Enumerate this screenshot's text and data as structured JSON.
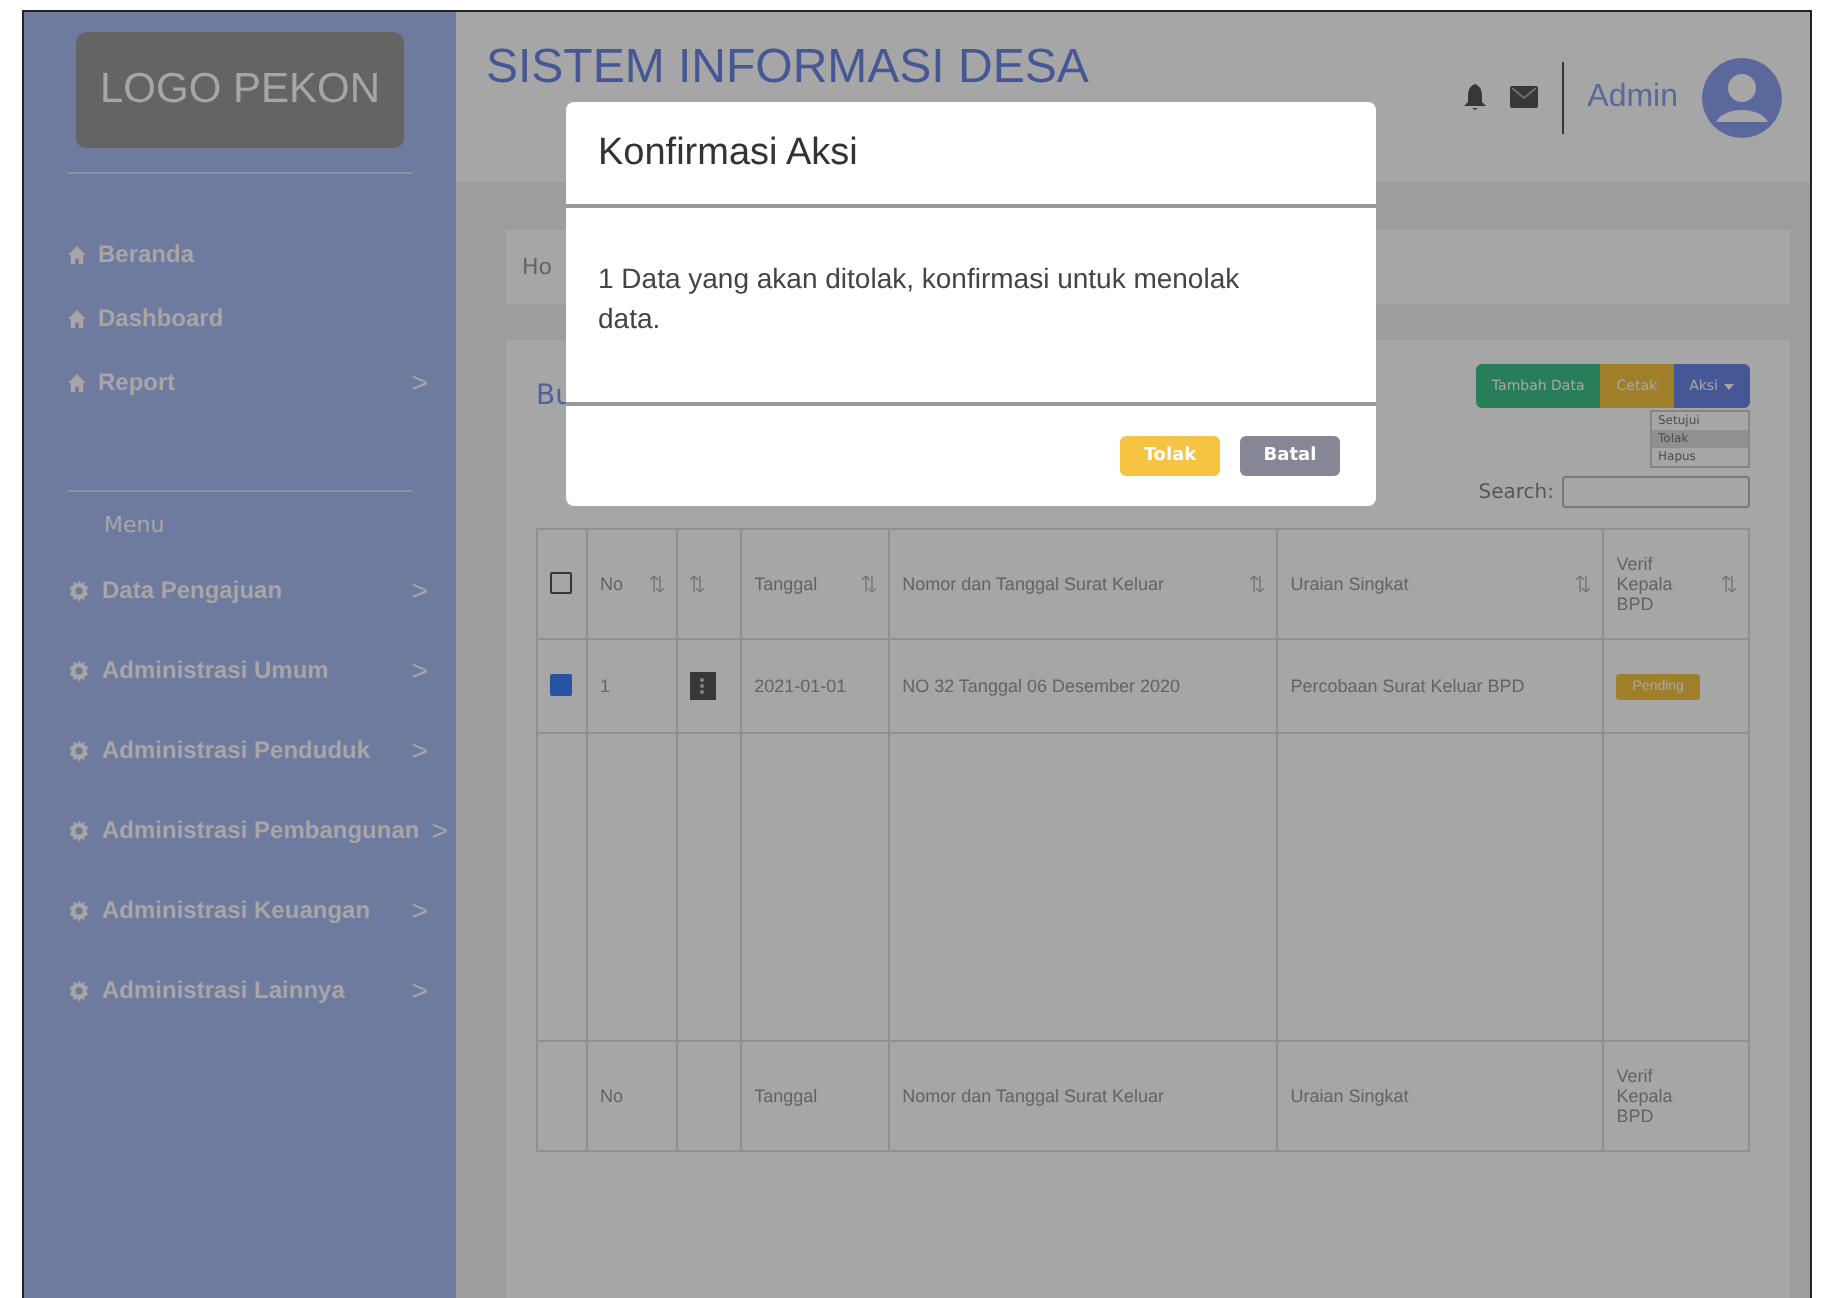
{
  "sidebar": {
    "logo": "LOGO PEKON",
    "top_items": [
      {
        "label": "Beranda",
        "has_arrow": false
      },
      {
        "label": "Dashboard",
        "has_arrow": false
      },
      {
        "label": "Report",
        "has_arrow": true
      }
    ],
    "section_label": "Menu",
    "items": [
      {
        "label": "Data Pengajuan"
      },
      {
        "label": "Administrasi Umum"
      },
      {
        "label": "Administrasi Penduduk"
      },
      {
        "label": "Administrasi Pembangunan"
      },
      {
        "label": "Administrasi Keuangan"
      },
      {
        "label": "Administrasi Lainnya"
      }
    ],
    "arrow": ">"
  },
  "header": {
    "title": "SISTEM INFORMASI DESA",
    "user": "Admin"
  },
  "breadcrumb": "Ho",
  "card": {
    "title": "Bu",
    "buttons": [
      {
        "label": "Tambah Data",
        "kind": "success"
      },
      {
        "label": "Cetak",
        "kind": "warning"
      },
      {
        "label": "Aksi",
        "kind": "primary"
      }
    ],
    "dropdown": [
      {
        "label": "Setujui",
        "selected": false
      },
      {
        "label": "Tolak",
        "selected": true
      },
      {
        "label": "Hapus",
        "selected": false
      }
    ],
    "search_label": "Search:"
  },
  "table": {
    "header_checked": false,
    "columns": [
      {
        "kind": "text",
        "label": "No"
      },
      {
        "kind": "actions"
      },
      {
        "kind": "text",
        "label": "Tanggal"
      },
      {
        "kind": "text",
        "label": "Nomor dan Tanggal Surat Keluar"
      },
      {
        "kind": "text",
        "label": "Uraian Singkat"
      },
      {
        "kind": "text",
        "label": "Verif Kepala BPD"
      }
    ],
    "rows": [
      {
        "checked": true,
        "no": "1",
        "tanggal": "2021-01-01",
        "nomor": "NO 32 Tanggal 06 Desember 2020",
        "uraian": "Percobaan Surat Keluar BPD",
        "status": "Pending"
      }
    ],
    "footer": [
      "No",
      "Tanggal",
      "Nomor dan Tanggal Surat Keluar",
      "Uraian Singkat",
      "Verif Kepala BPD"
    ]
  },
  "modal": {
    "title": "Konfirmasi Aksi",
    "message": "1 Data yang akan ditolak, konfirmasi untuk menolak data.",
    "buttons": [
      {
        "label": "Tolak",
        "kind": "warning"
      },
      {
        "label": "Batal",
        "kind": "secondary"
      }
    ]
  }
}
